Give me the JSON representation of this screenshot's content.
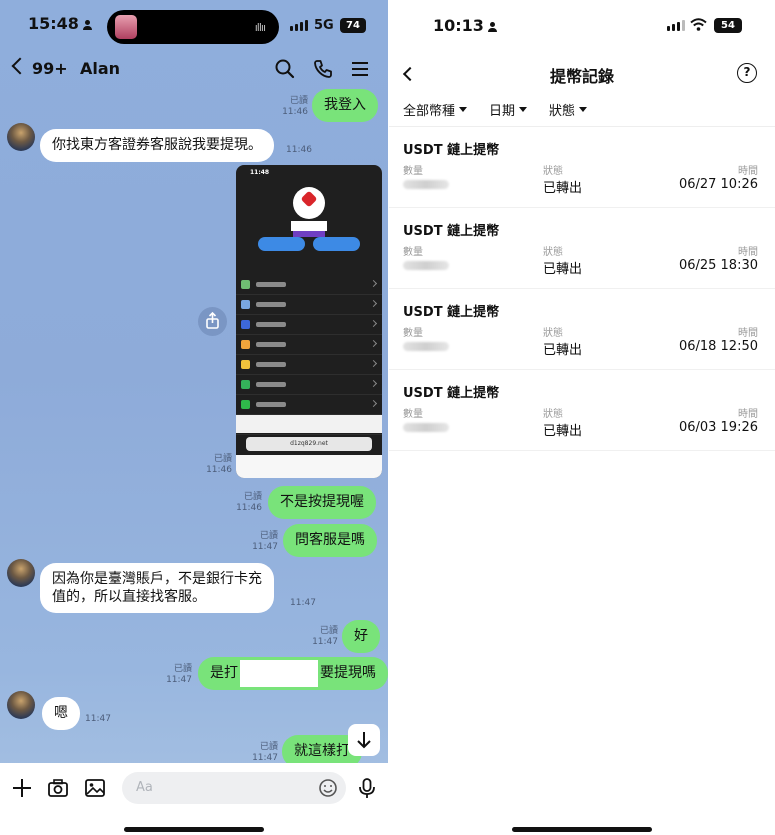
{
  "left": {
    "status": {
      "time": "15:48",
      "network": "5G",
      "battery": "74"
    },
    "header": {
      "back_badge": "99+",
      "contact": "Alan"
    },
    "messages": [
      {
        "side": "right",
        "text": "我登入",
        "read": "已讀",
        "time": "11:46"
      },
      {
        "side": "left",
        "text": "你找東方客證券客服說我要提現。",
        "time": "11:46"
      },
      {
        "side": "right",
        "type": "image",
        "read": "已讀",
        "time": "11:46",
        "inner_time": "11:48",
        "inner_url": "d1zq829.net"
      },
      {
        "side": "right",
        "text": "不是按提現喔",
        "read": "已讀",
        "time": "11:46"
      },
      {
        "side": "right",
        "text": "問客服是嗎",
        "read": "已讀",
        "time": "11:47"
      },
      {
        "side": "left",
        "line1": "因為你是臺灣賬戶，不是銀行卡充",
        "line2": "值的，所以直接找客服。",
        "time": "11:47"
      },
      {
        "side": "right",
        "text": "好",
        "read": "已讀",
        "time": "11:47"
      },
      {
        "side": "right",
        "prefix": "是打",
        "suffix": "要提現嗎",
        "read": "已讀",
        "time": "11:47"
      },
      {
        "side": "left",
        "text": "嗯",
        "time": "11:47"
      },
      {
        "side": "right",
        "text": "就這樣打",
        "read": "已讀",
        "time": "11:47"
      }
    ],
    "composer": {
      "placeholder": "Aa"
    }
  },
  "right": {
    "status": {
      "time": "10:13",
      "battery": "54"
    },
    "title": "提幣記錄",
    "filters": [
      "全部幣種",
      "日期",
      "狀態"
    ],
    "labels": {
      "amount": "數量",
      "status": "狀態",
      "time": "時間"
    },
    "records": [
      {
        "title": "USDT 鏈上提幣",
        "status": "已轉出",
        "time": "06/27 10:26"
      },
      {
        "title": "USDT 鏈上提幣",
        "status": "已轉出",
        "time": "06/25 18:30"
      },
      {
        "title": "USDT 鏈上提幣",
        "status": "已轉出",
        "time": "06/18 12:50"
      },
      {
        "title": "USDT 鏈上提幣",
        "status": "已轉出",
        "time": "06/03 19:26"
      }
    ]
  },
  "colors": {
    "chat_bg": "#8faedc",
    "bubble_green": "#79e37a",
    "bubble_white": "#ffffff"
  },
  "icons": [
    "search-icon",
    "phone-icon",
    "menu-icon",
    "plus-icon",
    "camera-icon",
    "image-icon",
    "emoji-icon",
    "mic-icon",
    "share-icon",
    "arrow-down-icon",
    "back-icon",
    "help-icon"
  ]
}
